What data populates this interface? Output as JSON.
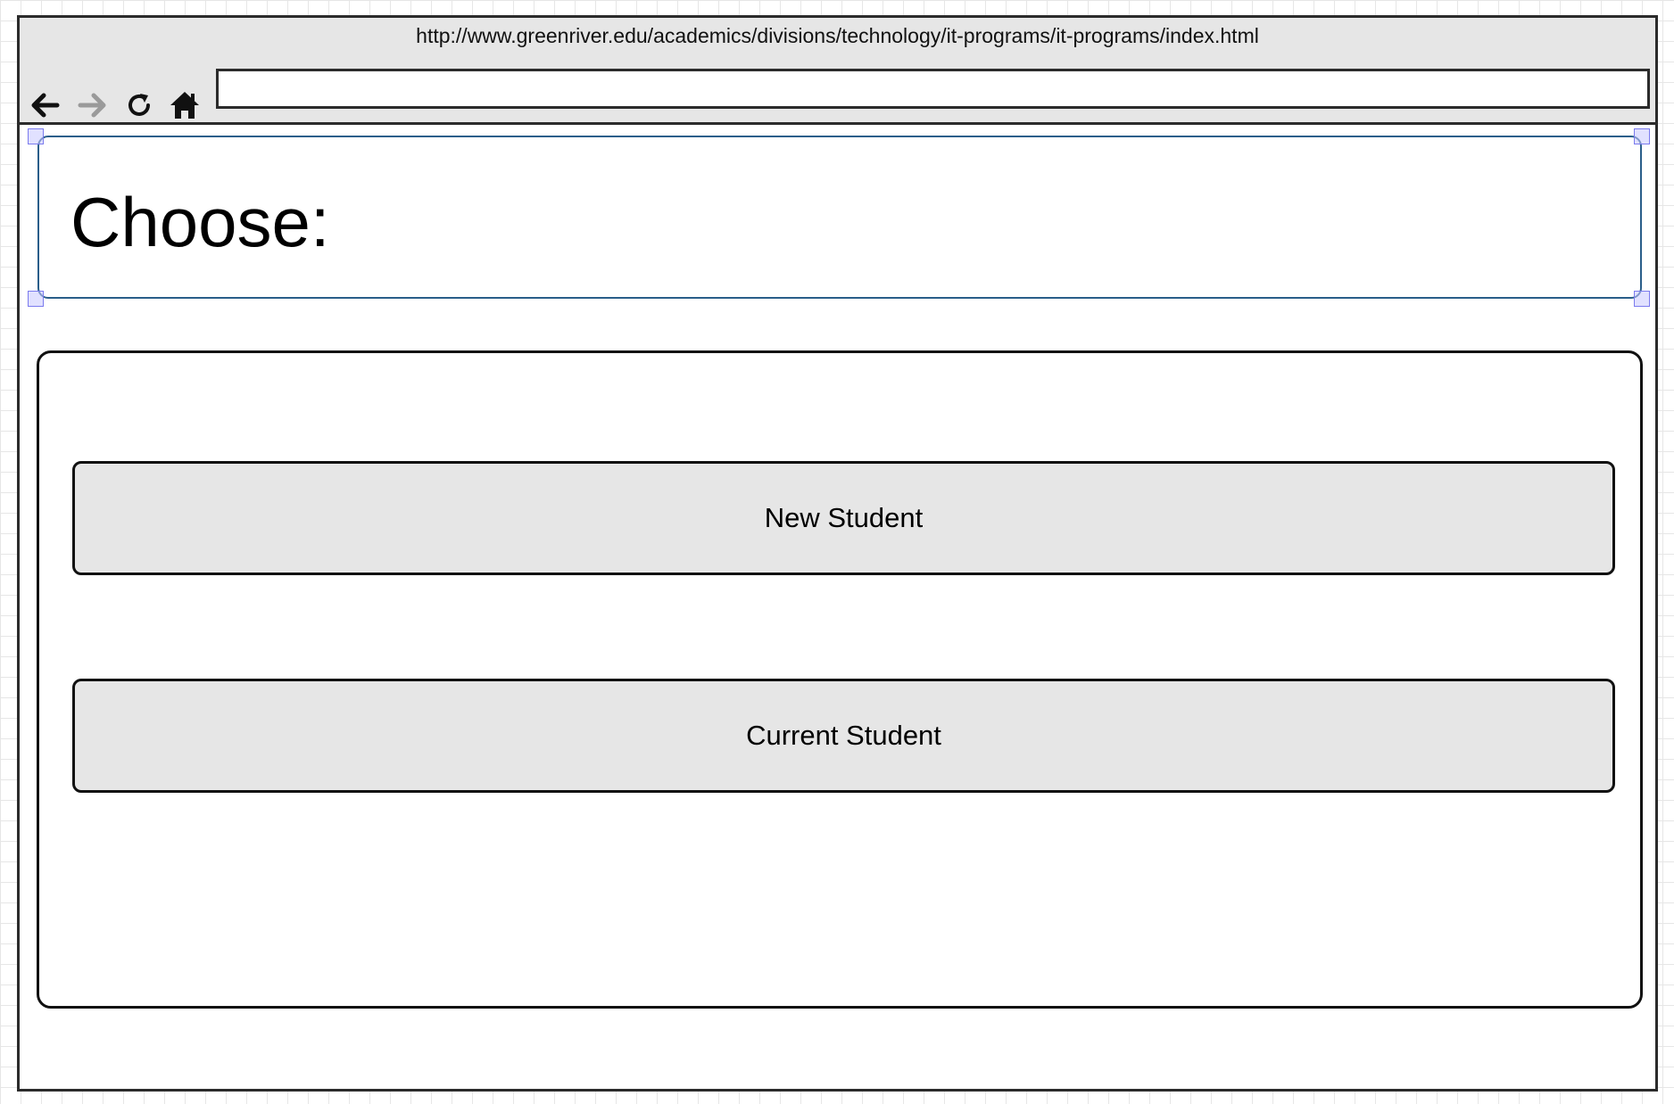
{
  "browser": {
    "url": "http://www.greenriver.edu/academics/divisions/technology/it-programs/it-programs/index.html",
    "address_bar_value": "",
    "nav_icons": [
      "back-arrow-icon",
      "forward-arrow-icon",
      "reload-icon",
      "home-icon"
    ]
  },
  "page": {
    "title": "Choose:",
    "buttons": {
      "new_student": "New Student",
      "current_student": "Current Student"
    }
  },
  "colors": {
    "chrome_background": "#e6e6e6",
    "frame_border": "#2b2b2b",
    "selection_border": "#2a5e8a",
    "selection_handle": "#7b7bee",
    "button_fill": "#e6e6e6",
    "forward_icon_disabled": "#9a9a9a"
  }
}
